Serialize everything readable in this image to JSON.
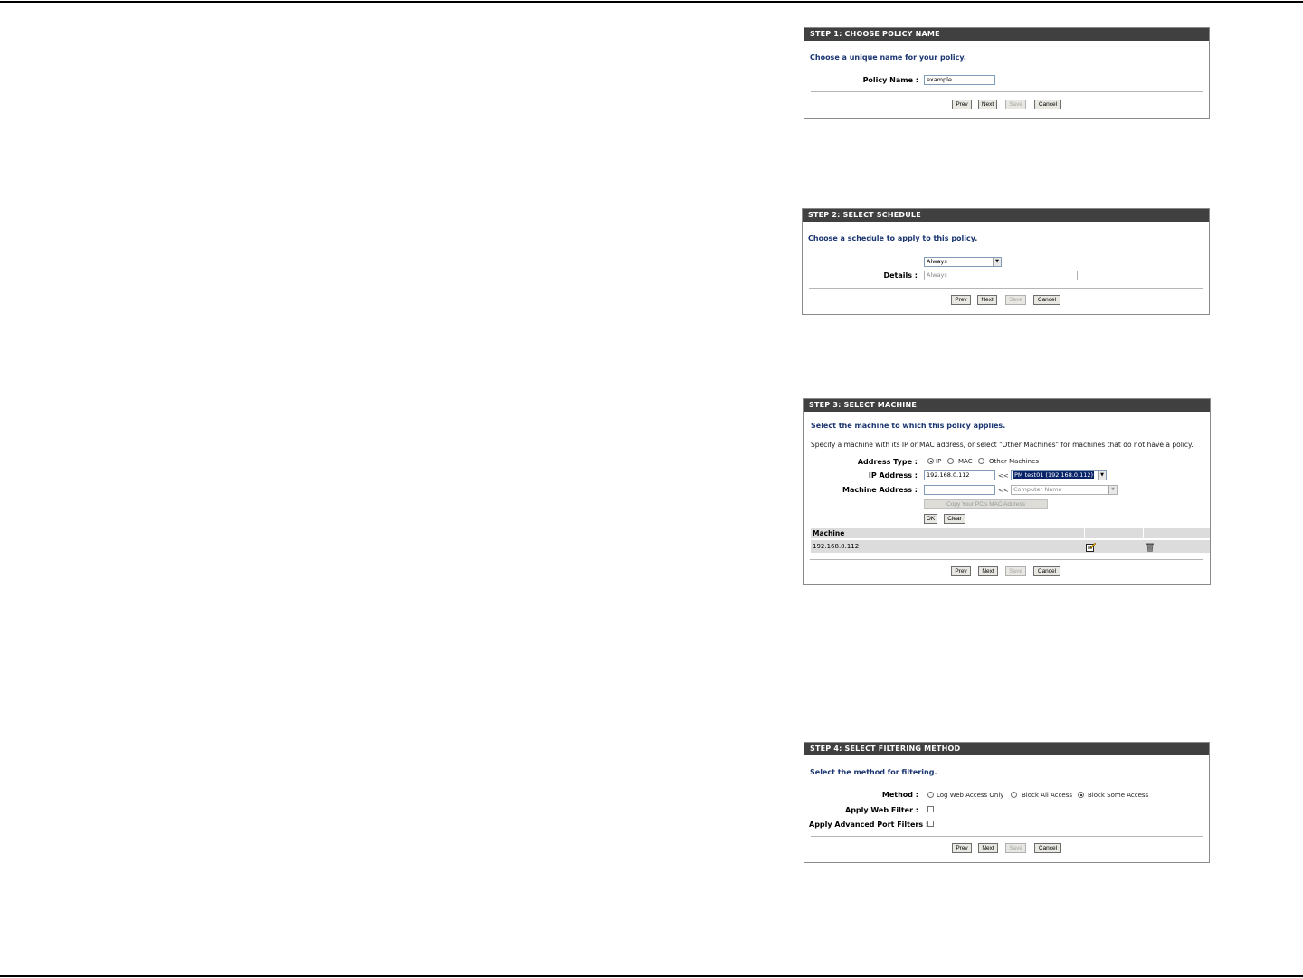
{
  "step1": {
    "title": "STEP 1: CHOOSE POLICY NAME",
    "intro": "Choose a unique name for your policy.",
    "policy_name_label": "Policy Name :",
    "policy_name_value": "example",
    "buttons": {
      "prev": "Prev",
      "next": "Next",
      "save": "Save",
      "cancel": "Cancel"
    }
  },
  "step2": {
    "title": "STEP 2: SELECT SCHEDULE",
    "intro": "Choose a schedule to apply to this policy.",
    "schedule_selected": "Always",
    "details_label": "Details :",
    "details_value": "Always",
    "buttons": {
      "prev": "Prev",
      "next": "Next",
      "save": "Save",
      "cancel": "Cancel"
    }
  },
  "step3": {
    "title": "STEP 3: SELECT MACHINE",
    "intro": "Select the machine to which this policy applies.",
    "note": "Specify a machine with its IP or MAC address, or select \"Other Machines\" for machines that do not have a policy.",
    "address_type_label": "Address Type :",
    "address_type_options": [
      "IP",
      "MAC",
      "Other Machines"
    ],
    "address_type_selected": "IP",
    "ip_address_label": "IP Address :",
    "ip_address_value": "192.168.0.112",
    "arrow_text": "<<",
    "ip_computer_selected": "PM test01 (192.168.0.112)",
    "machine_address_label": "Machine Address :",
    "machine_address_value": "",
    "computer_name_placeholder": "Computer Name",
    "copy_mac_button": "Copy Your PC's MAC Address",
    "ok_button": "OK",
    "clear_button": "Clear",
    "table": {
      "header": "Machine",
      "rows": [
        {
          "machine": "192.168.0.112"
        }
      ]
    },
    "buttons": {
      "prev": "Prev",
      "next": "Next",
      "save": "Save",
      "cancel": "Cancel"
    }
  },
  "step4": {
    "title": "STEP 4: SELECT FILTERING METHOD",
    "intro": "Select the method for filtering.",
    "method_label": "Method :",
    "method_options": [
      "Log Web Access Only",
      "Block All Access",
      "Block Some Access"
    ],
    "method_selected": "Block Some Access",
    "web_filter_label": "Apply Web Filter :",
    "web_filter_checked": false,
    "port_filters_label": "Apply Advanced Port Filters :",
    "port_filters_checked": false,
    "buttons": {
      "prev": "Prev",
      "next": "Next",
      "save": "Save",
      "cancel": "Cancel"
    }
  }
}
